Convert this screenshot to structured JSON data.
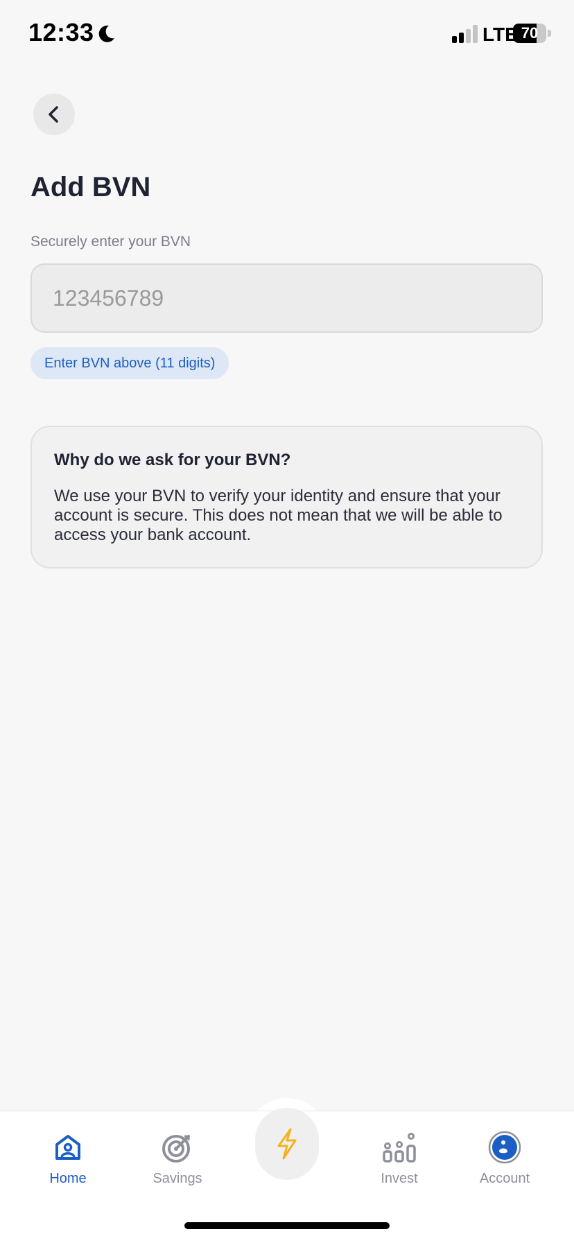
{
  "status_bar": {
    "time": "12:33",
    "network": "LTE",
    "battery_percent": "70",
    "battery_level": 0.7,
    "signal_bars": 2,
    "icons": [
      "moon-icon",
      "signal-icon",
      "battery-icon"
    ]
  },
  "header": {
    "back_icon": "chevron-left-icon",
    "title": "Add BVN"
  },
  "form": {
    "label": "Securely enter your BVN",
    "placeholder": "123456789",
    "value": "",
    "hint": "Enter BVN above (11 digits)"
  },
  "info_card": {
    "title": "Why do we ask for your BVN?",
    "body": "We use your BVN to verify your identity and ensure that your account is secure. This does not mean that we will be able to access your bank account."
  },
  "bottom_nav": {
    "items": [
      {
        "label": "Home",
        "icon": "home-icon",
        "active": true
      },
      {
        "label": "Savings",
        "icon": "target-icon",
        "active": false
      },
      {
        "label": "",
        "icon": "lightning-icon",
        "active": false
      },
      {
        "label": "Invest",
        "icon": "bar-chart-icon",
        "active": false
      },
      {
        "label": "Account",
        "icon": "account-icon",
        "active": false
      }
    ]
  },
  "colors": {
    "background": "#f7f7f7",
    "accent": "#1b5fc6",
    "hint_bg": "#dde7f5",
    "lightning": "#f2b21b",
    "inactive": "#8d909b"
  }
}
